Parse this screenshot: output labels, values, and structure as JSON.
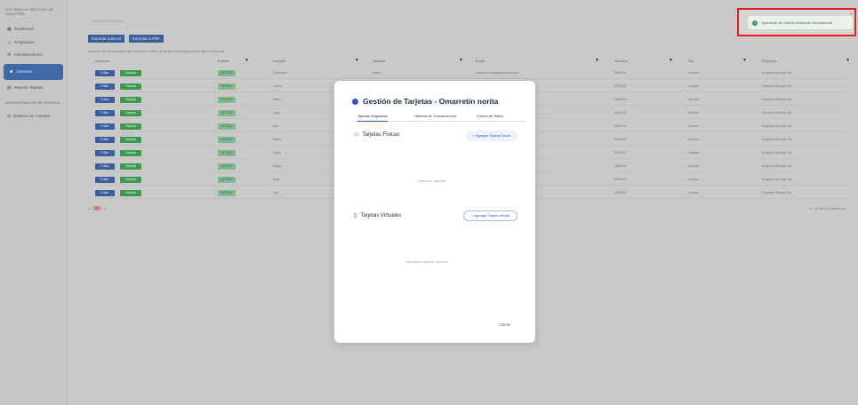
{
  "sidebar": {
    "title": "SISTEMA DE GESTIÓN DE TARJETAS",
    "items": [
      {
        "label": "Dashboard",
        "icon": "grid-icon"
      },
      {
        "label": "Empleados",
        "icon": "people-icon"
      },
      {
        "label": "Administradores",
        "icon": "admin-icon"
      },
      {
        "label": "Usuarios",
        "icon": "users-icon"
      },
      {
        "label": "Reporte Tarjetas",
        "icon": "report-icon"
      }
    ],
    "section": "ADMINISTRACIÓN DE CUENTAS",
    "section_items": [
      {
        "label": "Balance de Cuentas",
        "icon": "balance-icon"
      }
    ]
  },
  "main": {
    "search_placeholder": "Buscar usuarios...",
    "export_excel": "Exportar a Excel",
    "export_pdf": "Exportar a PDF",
    "hint": "Arrastre un encabezado de columna a la fila de arriba para agrupar por dicha columna.",
    "columns": [
      "Acciones",
      "Estado",
      "Nombre",
      "Apellido",
      "Email",
      "Teléfono",
      "Rol",
      "Empresa"
    ],
    "rows": [
      {
        "edit": "Editar",
        "cards": "Tarjetas",
        "status": "ACTIVO",
        "name": "Omarretin",
        "last": "Norita",
        "email": "omarretin.norita@empresa.com",
        "phone": "5550101",
        "role": "Usuario",
        "company": "Empresa Ejemplo SA"
      },
      {
        "edit": "Editar",
        "cards": "Tarjetas",
        "status": "ACTIVO",
        "name": "Carlos",
        "last": "Pérez",
        "email": "carlos.perez@empresa.com",
        "phone": "5550102",
        "role": "Usuario",
        "company": "Empresa Ejemplo SA"
      },
      {
        "edit": "Editar",
        "cards": "Tarjetas",
        "status": "ACTIVO",
        "name": "María",
        "last": "Gómez",
        "email": "maria.gomez@empresa.com",
        "phone": "5550103",
        "role": "Usuario",
        "company": "Empresa Ejemplo SA"
      },
      {
        "edit": "Editar",
        "cards": "Tarjetas",
        "status": "ACTIVO",
        "name": "Juan",
        "last": "López",
        "email": "juan.lopez@empresa.com",
        "phone": "5550104",
        "role": "Usuario",
        "company": "Empresa Ejemplo SA"
      },
      {
        "edit": "Editar",
        "cards": "Tarjetas",
        "status": "ACTIVO",
        "name": "Ana",
        "last": "Ruiz",
        "email": "ana.ruiz@empresa.com",
        "phone": "5550105",
        "role": "Usuario",
        "company": "Empresa Ejemplo SA"
      },
      {
        "edit": "Editar",
        "cards": "Tarjetas",
        "status": "ACTIVO",
        "name": "Pedro",
        "last": "Díaz",
        "email": "pedro.diaz@empresa.com",
        "phone": "5550106",
        "role": "Usuario",
        "company": "Empresa Ejemplo SA"
      },
      {
        "edit": "Editar",
        "cards": "Tarjetas",
        "status": "ACTIVO",
        "name": "Lucía",
        "last": "Torres",
        "email": "lucia.torres@empresa.com",
        "phone": "5550107",
        "role": "Usuario",
        "company": "Empresa Ejemplo SA"
      },
      {
        "edit": "Editar",
        "cards": "Tarjetas",
        "status": "ACTIVO",
        "name": "Diego",
        "last": "Vargas",
        "email": "diego.vargas@empresa.com",
        "phone": "5550108",
        "role": "Usuario",
        "company": "Empresa Ejemplo SA"
      },
      {
        "edit": "Editar",
        "cards": "Tarjetas",
        "status": "ACTIVO",
        "name": "Sofía",
        "last": "Castro",
        "email": "sofia.castro@empresa.com",
        "phone": "5550109",
        "role": "Usuario",
        "company": "Empresa Ejemplo SA"
      },
      {
        "edit": "Editar",
        "cards": "Tarjetas",
        "status": "ACTIVO",
        "name": "Luis",
        "last": "Mendoza",
        "email": "luis.mendoza@empresa.com",
        "phone": "5550110",
        "role": "Usuario",
        "company": "Empresa Ejemplo SA"
      }
    ],
    "pager": "« ‹",
    "pager_current": "1",
    "pager_next": "› »",
    "pager_info": "1 - 10 de 10 elementos"
  },
  "toast": {
    "text": "Operación de edición realizada exitosamente.",
    "close": "×"
  },
  "modal": {
    "title": "Gestión de Tarjetas - Omarretin norita",
    "tabs": [
      "Tarjetas Asignadas",
      "Historial de Transacciones",
      "Control de Saldo"
    ],
    "physical_title": "Tarjetas Físicas",
    "add_physical": "+ Agregar Tarjeta Física",
    "physical_loading": "Cargando tarjetas...",
    "virtual_title": "Tarjetas Virtuales",
    "add_virtual": "+ Agregar Tarjeta Virtual",
    "virtual_loading": "Cargando tarjetas virtuales...",
    "close": "Cerrar"
  },
  "colors": {
    "accent": "#2c52c4",
    "sidebar_active": "#3f6aa7",
    "success": "#3e9a4e",
    "highlight_border": "#e02020"
  }
}
